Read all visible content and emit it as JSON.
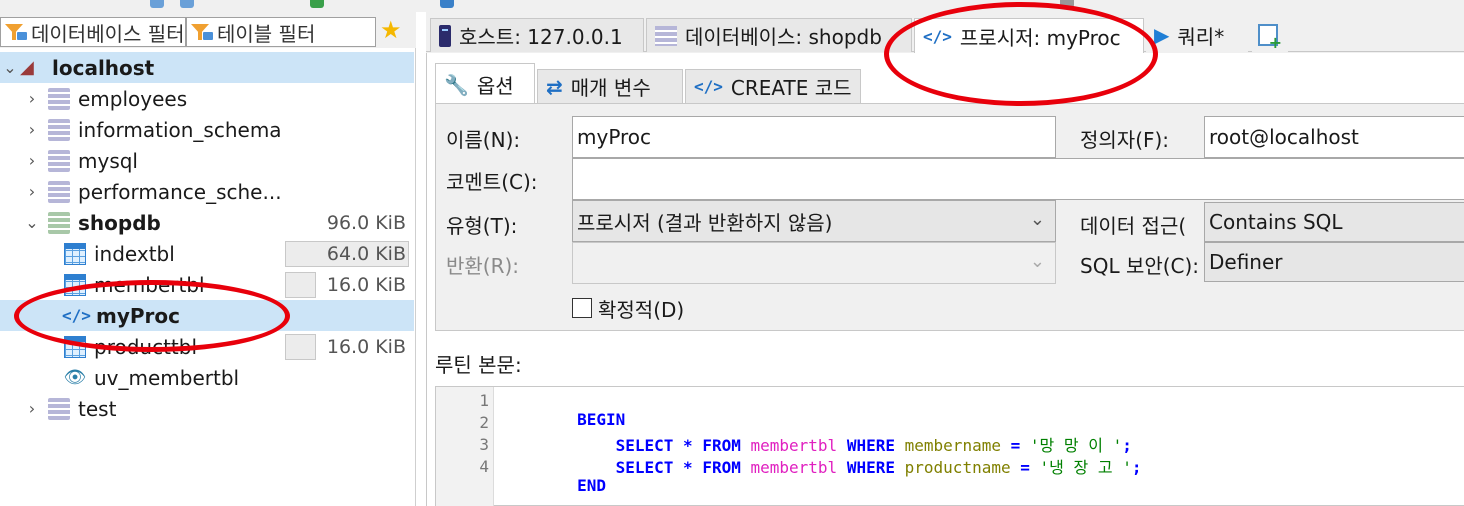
{
  "filters": {
    "database_filter": "데이터베이스 필터",
    "table_filter": "테이블 필터"
  },
  "tree": {
    "host": "localhost",
    "databases": [
      {
        "name": "employees"
      },
      {
        "name": "information_schema"
      },
      {
        "name": "mysql"
      },
      {
        "name": "performance_sche..."
      },
      {
        "name": "shopdb",
        "size": "96.0 KiB"
      }
    ],
    "shopdb_children": [
      {
        "name": "indextbl",
        "size": "64.0 KiB",
        "size_fraction": 0.67
      },
      {
        "name": "membertbl",
        "size": "16.0 KiB",
        "size_fraction": 0.17
      },
      {
        "name": "myProc"
      },
      {
        "name": "producttbl",
        "size": "16.0 KiB",
        "size_fraction": 0.17
      },
      {
        "name": "uv_membertbl"
      }
    ],
    "test_db": "test"
  },
  "tabs": {
    "host": "호스트: 127.0.0.1",
    "database": "데이터베이스: shopdb",
    "procedure": "프로시저: myProc",
    "query": "쿼리*"
  },
  "subtabs": {
    "options": "옵션",
    "params": "매개 변수",
    "create_code": "CREATE 코드"
  },
  "form": {
    "name_label": "이름(N):",
    "name_value": "myProc",
    "definer_label": "정의자(F):",
    "definer_value": "root@localhost",
    "comment_label": "코멘트(C):",
    "comment_value": "",
    "type_label": "유형(T):",
    "type_value": "프로시저 (결과 반환하지 않음)",
    "data_access_label": "데이터 접근(",
    "data_access_value": "Contains SQL",
    "return_label": "반환(R):",
    "return_value": "",
    "security_label": "SQL 보안(C):",
    "security_value": "Definer",
    "deterministic_label": "확정적(D)",
    "deterministic_checked": false
  },
  "routine_body": {
    "label": "루틴 본문:",
    "line_numbers": [
      "1",
      "2",
      "3",
      "4"
    ],
    "line1": "BEGIN",
    "line2": {
      "kw1": "SELECT",
      "star": "*",
      "kw2": "FROM",
      "table": "membertbl",
      "kw3": "WHERE",
      "column": "membername",
      "eq": "=",
      "value": "'망 망 이 '",
      "end": ";"
    },
    "line3": {
      "kw1": "SELECT",
      "star": "*",
      "kw2": "FROM",
      "table": "membertbl",
      "kw3": "WHERE",
      "column": "productname",
      "eq": "=",
      "value": "'냉 장 고 '",
      "end": ";"
    },
    "line4": "END"
  },
  "colors": {
    "selection": "#cce4f7",
    "annotation": "#e8000b",
    "keyword": "#0000ff",
    "table_name": "#e020c0",
    "string": "#008000"
  }
}
